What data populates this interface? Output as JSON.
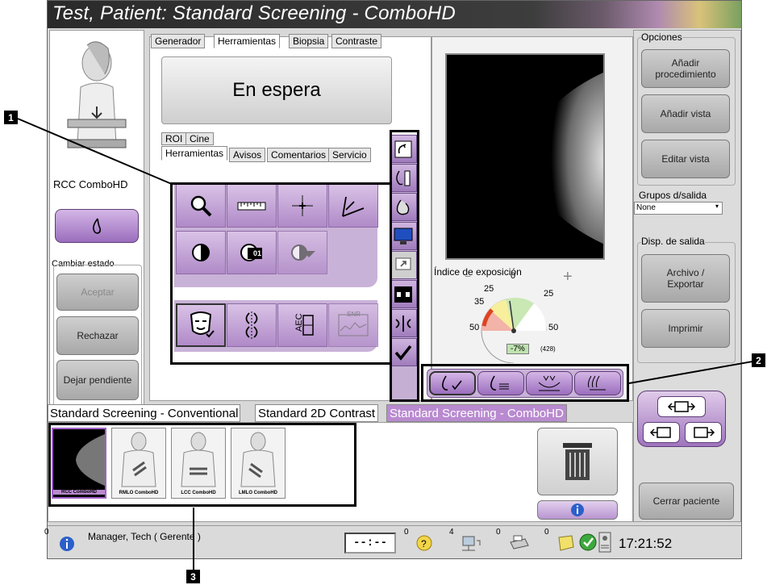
{
  "window": {
    "title": "Test, Patient:  Standard Screening - ComboHD"
  },
  "patient_panel": {
    "view_label": "RCC ComboHD",
    "state_group_label": "Cambiar estado",
    "accept_label": "Aceptar",
    "reject_label": "Rechazar",
    "pending_label": "Dejar pendiente"
  },
  "main_tabs": [
    "Generador",
    "Herramientas",
    "Biopsia",
    "Contraste"
  ],
  "status_display": "En espera",
  "sub_tabs_row1": [
    "ROI",
    "Cine"
  ],
  "sub_tabs_row2": [
    "Herramientas",
    "Avisos",
    "Comentarios",
    "Servicio"
  ],
  "tool_icons": [
    "magnifier-icon",
    "ruler-icon",
    "crosshair-icon",
    "calipers-icon",
    "contrast-icon",
    "contrast-preset-icon",
    "auto-contrast-icon",
    "face-icon",
    "flip-icon",
    "aec-icon",
    "snr-icon"
  ],
  "tool_labels": {
    "preset": "01",
    "aec": "AEC",
    "snr": "SNR"
  },
  "vertical_tool_icons": [
    "rotate-icon",
    "ruler-marker-icon",
    "implant-icon",
    "monitor-icon",
    "export-icon",
    "split-view-icon",
    "compare-icon",
    "accept-check-icon"
  ],
  "exposure": {
    "title": "Índice de exposición",
    "minus": "−",
    "plus": "+",
    "ticks": [
      "0",
      "25",
      "25",
      "35",
      "50",
      "50"
    ],
    "value": "-7%",
    "raw": "(428)"
  },
  "series_tabs": [
    "Standard Screening - Conventional",
    "Standard 2D Contrast",
    "Standard Screening - ComboHD"
  ],
  "thumbnails": [
    "RCC ComboHD",
    "RMLO ComboHD",
    "LCC ComboHD",
    "LMLO ComboHD"
  ],
  "options": {
    "group_label": "Opciones",
    "add_procedure": "Añadir procedimiento",
    "add_view": "Añadir vista",
    "edit_view": "Editar vista",
    "output_groups_label": "Grupos d/salida",
    "output_groups_value": "None",
    "output_device_label": "Disp. de salida",
    "archive_export": "Archivo / Exportar",
    "print": "Imprimir",
    "close_patient": "Cerrar paciente"
  },
  "status_bar": {
    "count_left": "0",
    "user": "Manager, Tech ( Gerente )",
    "timer": "--:--",
    "counts": [
      "0",
      "4",
      "0",
      "0"
    ],
    "time": "17:21:52"
  },
  "callouts": [
    "1",
    "2",
    "3"
  ],
  "colors": {
    "accent_purple": "#9b6ebd",
    "title_bg": "#2a2a2a",
    "active_series_tab": "#b98ad0"
  }
}
